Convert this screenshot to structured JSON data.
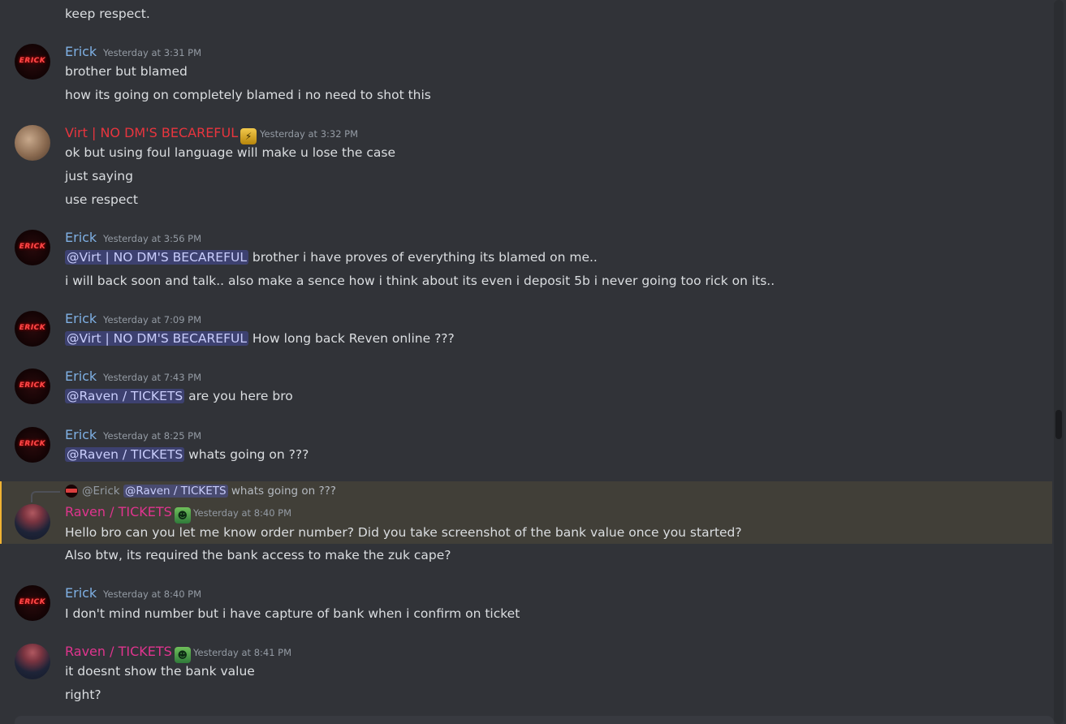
{
  "colors": {
    "background": "#313338",
    "erick_name": "#7fb0e4",
    "virt_name": "#e8353e",
    "raven_name": "#e0348e",
    "timestamp": "#949ba4",
    "mention_bg": "#4a4f8a",
    "highlight_bg": "#413f38",
    "highlight_bar": "#f0b232"
  },
  "messages": [
    {
      "lines": [
        "keep respect."
      ]
    },
    {
      "author": "Erick",
      "time": "Yesterday at 3:31 PM",
      "lines": [
        "brother but blamed",
        "how its going on completely blamed i no need to shot this"
      ]
    },
    {
      "author": "Virt | NO DM'S BECAREFUL",
      "time": "Yesterday at 3:32 PM",
      "lines": [
        "ok but using foul language will make u lose the case",
        "just saying",
        "use respect"
      ]
    },
    {
      "author": "Erick",
      "time": "Yesterday at 3:56 PM",
      "mention": "@Virt | NO DM'S BECAREFUL",
      "lines": [
        "brother i have proves of everything its blamed on me..",
        "i will back soon and talk..  also make a sence how i think about its even i deposit 5b i never going too rick on its.."
      ]
    },
    {
      "author": "Erick",
      "time": "Yesterday at 7:09 PM",
      "mention": "@Virt | NO DM'S BECAREFUL",
      "lines": [
        "How long back Reven online ???"
      ]
    },
    {
      "author": "Erick",
      "time": "Yesterday at 7:43 PM",
      "mention": "@Raven / TICKETS",
      "lines": [
        "are you here bro"
      ]
    },
    {
      "author": "Erick",
      "time": "Yesterday at 8:25 PM",
      "mention": "@Raven / TICKETS",
      "lines": [
        "whats going on ???"
      ]
    },
    {
      "reply": {
        "user": "@Erick",
        "mention": "@Raven / TICKETS",
        "text": "whats going on ???"
      },
      "author": "Raven / TICKETS",
      "time": "Yesterday at 8:40 PM",
      "lines": [
        "Hello bro can you let me know order number? Did you take screenshot of the bank value once you started?",
        "Also btw, its required the bank access to make the zuk cape?"
      ]
    },
    {
      "author": "Erick",
      "time": "Yesterday at 8:40 PM",
      "lines": [
        "I don't mind number but i have capture of bank when i confirm on ticket"
      ]
    },
    {
      "author": "Raven / TICKETS",
      "time": "Yesterday at 8:41 PM",
      "lines": [
        "it doesnt show the bank value",
        "right?"
      ]
    }
  ],
  "avatars": {
    "erick": "ERICK",
    "badge_virt": "gold-badge-icon",
    "badge_raven": "pepe-emoji-icon"
  }
}
